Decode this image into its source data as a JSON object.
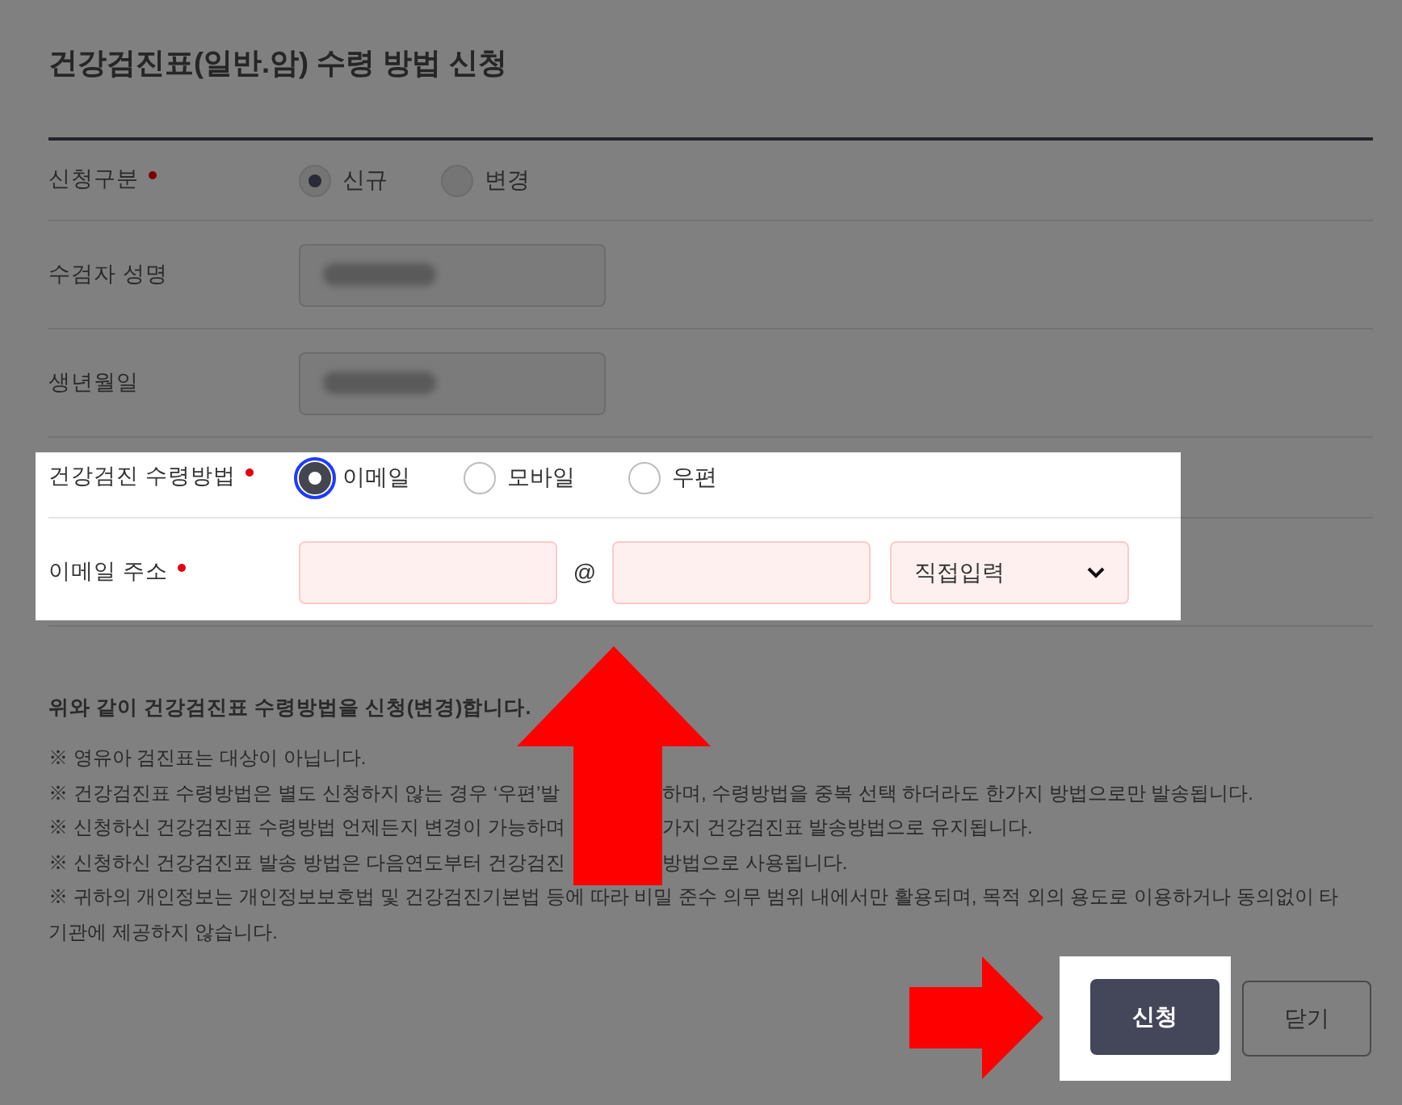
{
  "title": "건강검진표(일반.암) 수령 방법 신청",
  "rows": [
    {
      "kind": "radio",
      "label": "신청구분",
      "required": true,
      "highlighted": false,
      "options": [
        {
          "label": "신규",
          "selected": true
        },
        {
          "label": "변경",
          "selected": false
        }
      ]
    },
    {
      "kind": "text",
      "label": "수검자 성명",
      "required": false,
      "highlighted": false,
      "redacted": true
    },
    {
      "kind": "text",
      "label": "생년월일",
      "required": false,
      "highlighted": false,
      "redacted": true
    },
    {
      "kind": "radio",
      "label": "건강검진 수령방법",
      "required": true,
      "highlighted": true,
      "options": [
        {
          "label": "이메일",
          "selected": true
        },
        {
          "label": "모바일",
          "selected": false
        },
        {
          "label": "우편",
          "selected": false
        }
      ]
    },
    {
      "kind": "email",
      "label": "이메일 주소",
      "required": true,
      "highlighted": true,
      "separator": "@",
      "domain_select": "직접입력"
    }
  ],
  "notice": {
    "heading": "위와 같이 건강검진표 수령방법을 신청(변경)합니다.",
    "lines": [
      {
        "segments": [
          "※ 영유아 검진표는 대상이 아닙니다."
        ]
      },
      {
        "segments": [
          "※ 건강검진표 수령방법은 별도 신청하지 않는 경우 ‘우편’발",
          "하며, 수령방법을 중복 선택 하더라도 한가지 방법으로만 발송됩니다."
        ]
      },
      {
        "segments": [
          "※ 신청하신 건강검진표 수령방법 언제든지 변경이 가능하며",
          "가지 건강검진표 발송방법으로 유지됩니다."
        ]
      },
      {
        "segments": [
          "※ 신청하신 건강검진표 발송 방법은 다음연도부터 건강검진",
          "방법으로 사용됩니다."
        ]
      },
      {
        "segments": [
          "※ 귀하의 개인정보는 개인정보보호법 및 건강검진기본법 등에 따라 비밀 준수 의무 범위 내에서만 활용되며, 목적 외의 용도로 이용하거나 동의없이 타 기관에 제공하지 않습니다."
        ]
      }
    ]
  },
  "buttons": [
    {
      "label": "신청",
      "kind": "primary",
      "highlighted": true
    },
    {
      "label": "닫기",
      "kind": "secondary",
      "highlighted": false
    }
  ]
}
